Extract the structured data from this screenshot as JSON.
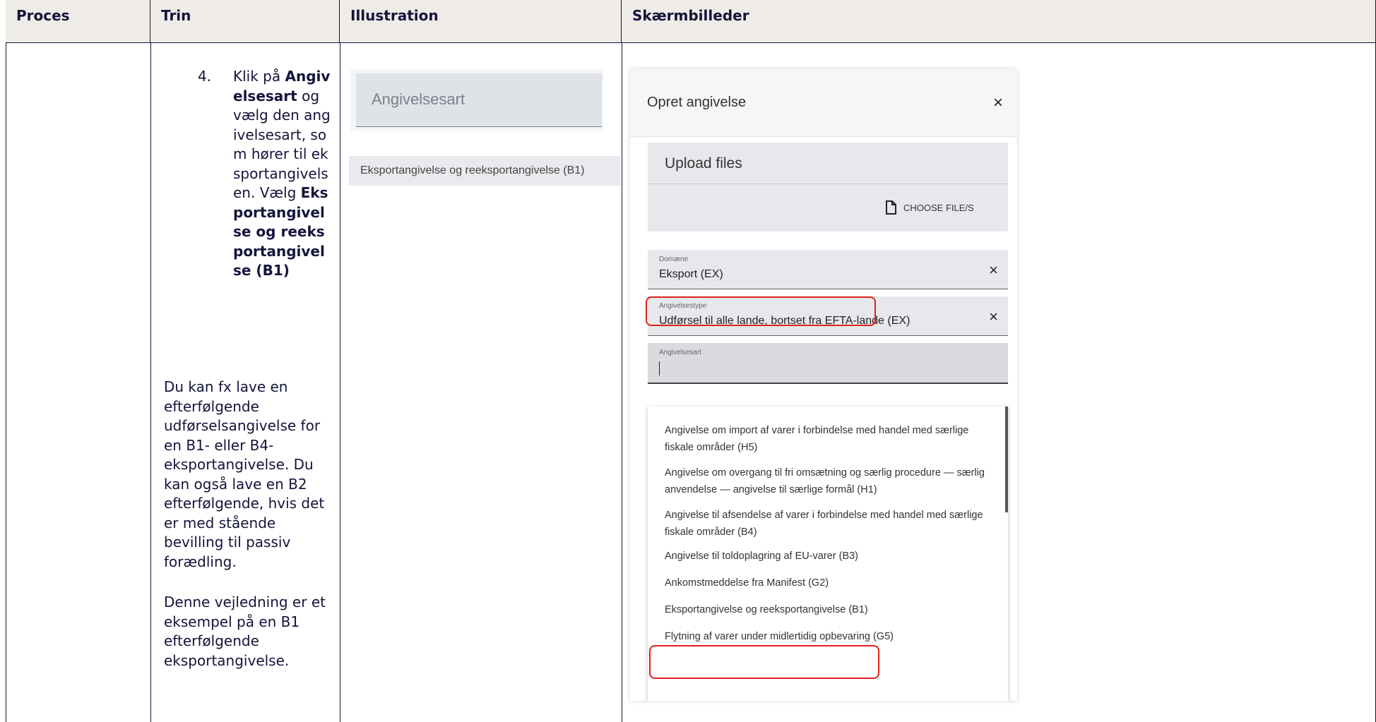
{
  "headers": [
    "Proces",
    "Trin",
    "Illustration",
    "Skærmbilleder"
  ],
  "step": {
    "number": "4.",
    "text_1": "Klik på ",
    "bold_1": "Angivelsesart",
    "text_2": " og vælg den angivelsesart, som hører til eksportangivelsen. Vælg ",
    "bold_2": "Eksportangivelse og reeksportangivelse (B1)"
  },
  "paragraphs": [
    "Du kan fx lave en efterfølgende udførselsangivelse for en B1- eller B4-eksportangivelse. Du kan også lave en B2 efterfølgende, hvis det er med stående bevilling til passiv forædling.",
    "Denne vejledning er et eksempel på en B1 efterfølgende eksportangivelse."
  ],
  "illustration": {
    "field_placeholder": "Angivelsesart",
    "option": "Eksportangivelse og reeksportangivelse (B1)"
  },
  "screen": {
    "title": "Opret angivelse",
    "upload_title": "Upload files",
    "choose_files": "CHOOSE FILE/S",
    "fields": [
      {
        "label": "Domæne",
        "value": "Eksport (EX)"
      },
      {
        "label": "Angivelsestype",
        "value": "Udførsel til alle lande, bortset fra EFTA-lande (EX)"
      },
      {
        "label": "Angivelsesart",
        "value": ""
      }
    ],
    "options": [
      "Angivelse om import af varer i forbindelse med handel med særlige fiskale områder (H5)",
      "Angivelse om overgang til fri omsætning og særlig procedure — særlig anvendelse — angivelse til særlige formål (H1)",
      "Angivelse til afsendelse af varer i forbindelse med handel med særlige fiskale områder (B4)",
      "Angivelse til toldoplagring af EU-varer (B3)",
      "Ankomstmeddelse fra Manifest (G2)",
      "Eksportangivelse og reeksportangivelse (B1)",
      "Flytning af varer under midlertidig opbevaring (G5)"
    ],
    "close_glyph": "×",
    "highlight_color": "#e0201b"
  }
}
